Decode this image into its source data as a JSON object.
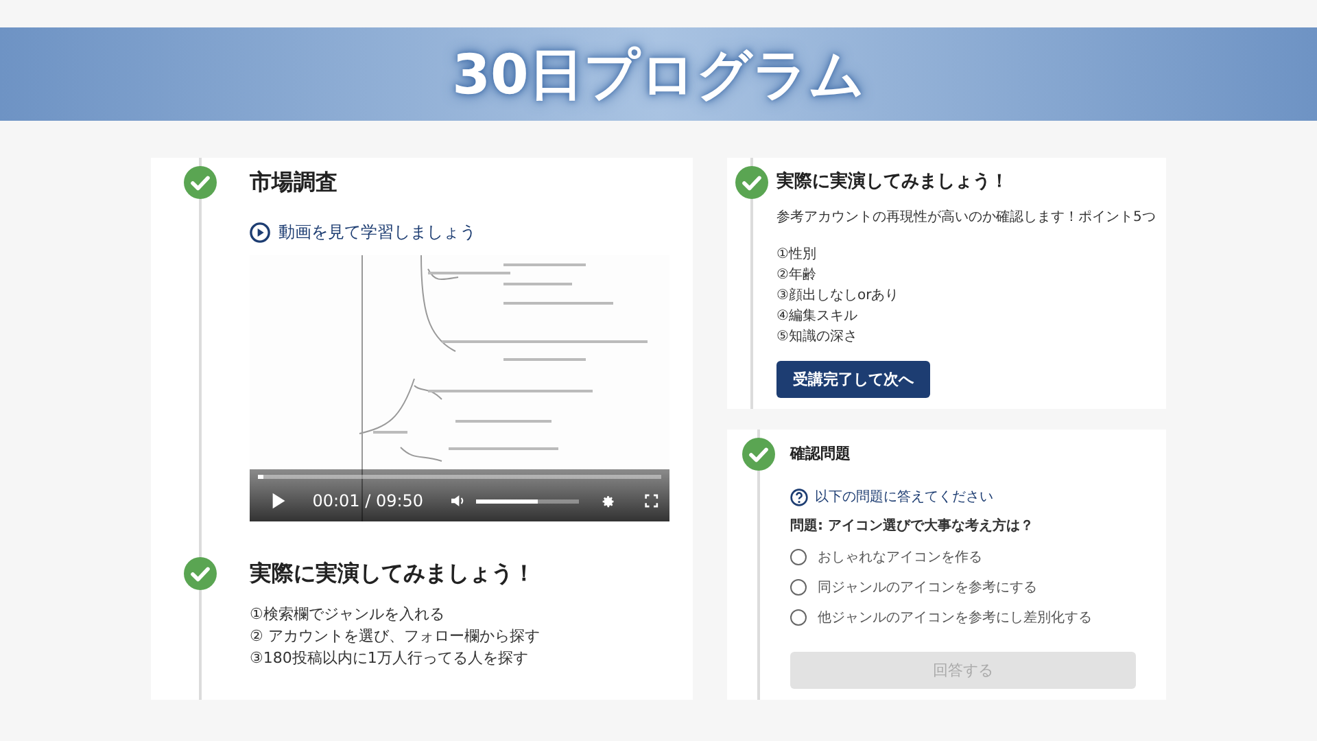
{
  "banner": {
    "title": "30日プログラム"
  },
  "left_card": {
    "sections": [
      {
        "kind": "video",
        "title": "市場調査",
        "completed": true,
        "video_link": "動画を見て学習しましょう",
        "video": {
          "playing": false,
          "time": "00:01 / 09:50",
          "progress": {
            "level": 0.01
          },
          "volume": {
            "level": 0.6
          }
        }
      },
      {
        "kind": "text",
        "title": "実際に実演してみましょう！",
        "completed": true,
        "lines": [
          "①検索欄でジャンルを入れる",
          "② アカウントを選び、フォロー欄から探す",
          "③180投稿以内に1万人行ってる人を探す"
        ]
      }
    ]
  },
  "practice_card": {
    "title": "実際に実演してみましょう！",
    "completed": true,
    "intro": "参考アカウントの再現性が高いのか確認します！ポイント5つ",
    "lines": [
      "①性別",
      "②年齢",
      "③顔出しなしorあり",
      "④編集スキル",
      "⑤知識の深さ"
    ],
    "button": "受講完了して次へ"
  },
  "quiz_card": {
    "title": "確認問題",
    "completed": true,
    "prompt": "以下の問題に答えてください",
    "question": "問題: アイコン選びで大事な考え方は？",
    "options": [
      {
        "label": "おしゃれなアイコンを作る",
        "selected": false
      },
      {
        "label": "同ジャンルのアイコンを参考にする",
        "selected": false
      },
      {
        "label": "他ジャンルのアイコンを参考にし差別化する",
        "selected": false
      }
    ],
    "submit": {
      "label": "回答する",
      "disabled": true
    }
  }
}
